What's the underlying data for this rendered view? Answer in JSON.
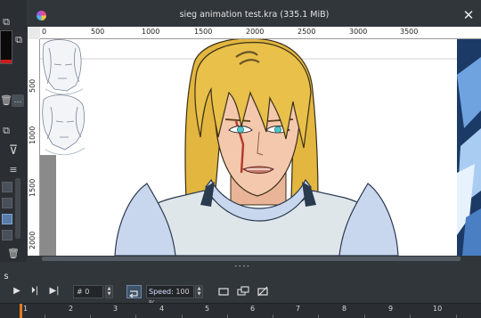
{
  "window": {
    "title": "sieg animation test.kra (335.1 MiB)",
    "close_glyph": "✕"
  },
  "rulers": {
    "top_labels": [
      "0",
      "500",
      "1000",
      "1500",
      "2000",
      "2500",
      "3000",
      "3500"
    ],
    "left_labels": [
      "500",
      "1000",
      "1500",
      "2000"
    ]
  },
  "left_docker": {
    "icons": [
      "window-restore-icon",
      "window-restore-icon",
      "trash-icon",
      "more-button",
      "window-restore-icon",
      "filter-icon",
      "menu-icon",
      "trash-icon"
    ],
    "more_label": "…"
  },
  "animation": {
    "frame_prefix": "#",
    "frame_value": "0",
    "speed_label": "Speed:",
    "speed_value": "100 %",
    "icons": [
      "rewind-icon",
      "play-icon",
      "next-frame-icon",
      "last-frame-icon",
      "loop-icon",
      "canvas-icon",
      "copy-layers-icon",
      "no-drop-frames-icon"
    ]
  },
  "timeline": {
    "frames": [
      "1",
      "2",
      "3",
      "4",
      "5",
      "6",
      "7",
      "8",
      "9",
      "10"
    ]
  },
  "colors": {
    "bg": "#31363b",
    "accent_orange": "#e57a20",
    "hair": "#e8c04a",
    "skin": "#f4c8ad",
    "armor_light": "#c9d7ee",
    "armor_dark": "#2a3a4f",
    "eye": "#4ec6c9"
  }
}
